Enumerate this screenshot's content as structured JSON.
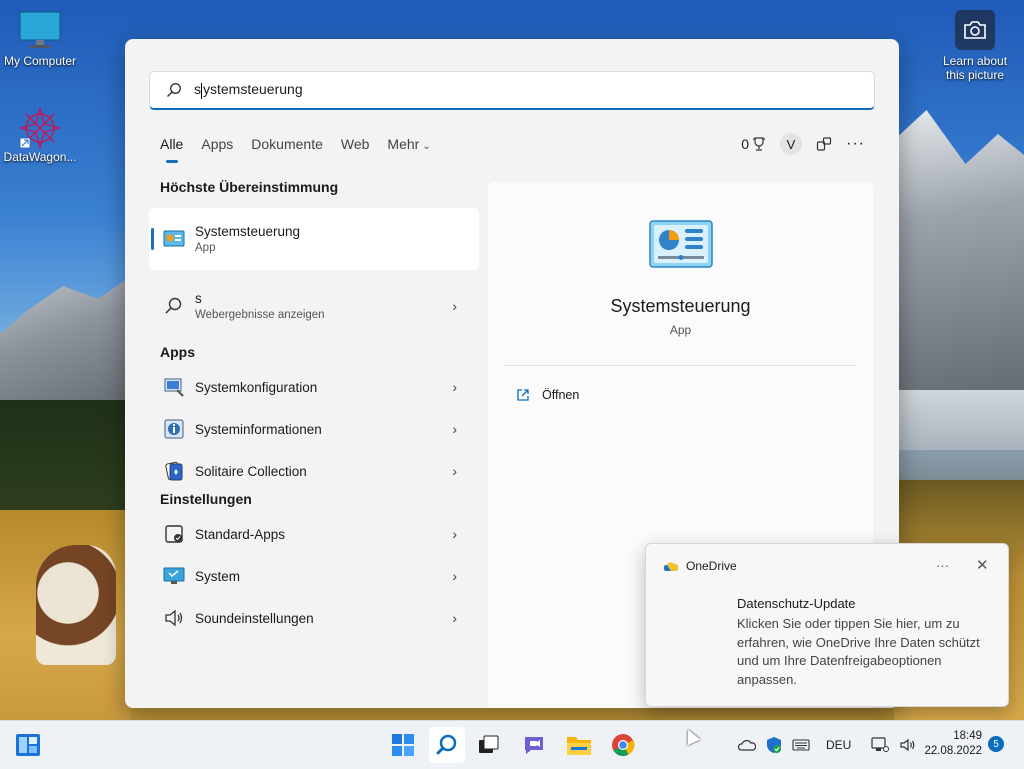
{
  "desktop": {
    "icons": [
      {
        "label": "My Computer"
      },
      {
        "label": "DataWagon..."
      }
    ],
    "learn_more": {
      "line1": "Learn about",
      "line2": "this picture"
    }
  },
  "search": {
    "query": "systemsteuerung",
    "query_first": "s",
    "query_rest": "ystemsteuerung",
    "tabs": [
      {
        "label": "Alle"
      },
      {
        "label": "Apps"
      },
      {
        "label": "Dokumente"
      },
      {
        "label": "Web"
      },
      {
        "label": "Mehr"
      }
    ],
    "rewards_count": "0",
    "avatar_initial": "V",
    "more_dots": "···"
  },
  "results": {
    "best_match_heading": "Höchste Übereinstimmung",
    "best_match": {
      "title": "Systemsteuerung",
      "subtitle": "App"
    },
    "web": {
      "title": "s",
      "subtitle": "Webergebnisse anzeigen"
    },
    "apps_heading": "Apps",
    "apps": [
      {
        "label": "Systemkonfiguration"
      },
      {
        "label": "Systeminformationen"
      },
      {
        "label": "Solitaire Collection"
      }
    ],
    "settings_heading": "Einstellungen",
    "settings": [
      {
        "label": "Standard-Apps"
      },
      {
        "label": "System"
      },
      {
        "label": "Soundeinstellungen"
      }
    ]
  },
  "preview": {
    "title": "Systemsteuerung",
    "subtitle": "App",
    "open_label": "Öffnen"
  },
  "toast": {
    "app": "OneDrive",
    "more": "···",
    "close": "✕",
    "title": "Datenschutz-Update",
    "body": "Klicken Sie oder tippen Sie hier, um zu erfahren, wie OneDrive Ihre Daten schützt und um Ihre Datenfreigabeoptionen anpassen."
  },
  "taskbar": {
    "language": "DEU",
    "time": "18:49",
    "date": "22.08.2022",
    "notification_count": "5"
  },
  "colors": {
    "accent": "#0a6cbd"
  }
}
